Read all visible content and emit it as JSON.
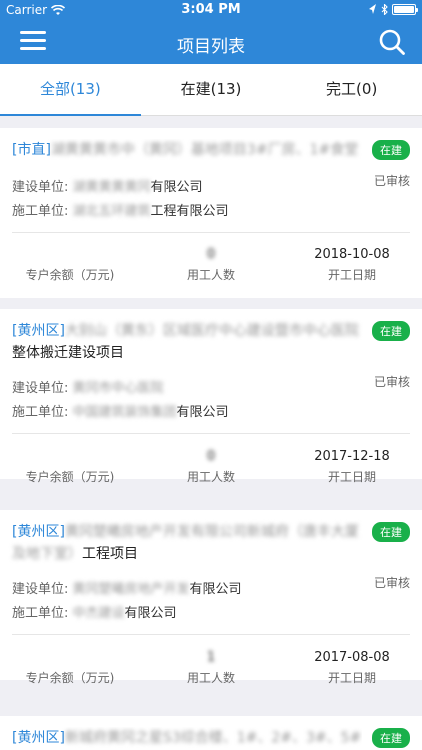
{
  "status": {
    "carrier": "Carrier",
    "time": "3:04 PM"
  },
  "nav": {
    "title": "项目列表"
  },
  "tabs": [
    {
      "label": "全部(13)",
      "active": true
    },
    {
      "label": "在建(13)",
      "active": false
    },
    {
      "label": "完工(0)",
      "active": false
    }
  ],
  "labels": {
    "builder": "建设单位:",
    "contractor": "施工单位:",
    "balance": "专户余额（万元)",
    "workers": "用工人数",
    "start_date": "开工日期"
  },
  "projects": [
    {
      "region": "[市直]",
      "name_blur": "湖黄黄黄市中（黄冈）基地项目3#厂房、1#食堂",
      "name": "",
      "badge": "在建",
      "builder_blur": "湖黄黄黄黄冈",
      "builder": "有限公司",
      "contractor_blur": "湖北五环建筑",
      "contractor": "工程有限公司",
      "audit": "已审核",
      "balance": "",
      "workers": "0",
      "start_date": "2018-10-08"
    },
    {
      "region": "[黄州区]",
      "name_blur": "大别山（黄东）区域医疗中心建设暨市中心医院",
      "name": "整体搬迁建设项目",
      "badge": "在建",
      "builder_blur": "黄冈市中心医院",
      "builder": "",
      "contractor_blur": "中国建筑装饰集团",
      "contractor": "有限公司",
      "audit": "已审核",
      "balance": "",
      "workers": "0",
      "start_date": "2017-12-18"
    },
    {
      "region": "[黄州区]",
      "name_blur": "黄冈楚曦房地产开发有限公司新城府（唐丰大厦及地下室）",
      "name": "工程项目",
      "badge": "在建",
      "builder_blur": "黄冈楚曦房地产开发",
      "builder": "有限公司",
      "contractor_blur": "中杰建设",
      "contractor": "有限公司",
      "audit": "已审核",
      "balance": "",
      "workers": "1",
      "start_date": "2017-08-08"
    },
    {
      "region": "[黄州区]",
      "name_blur": "新城府黄冈之星S3综合楼、1#、2#、3#、5#",
      "name": "",
      "badge": "在建"
    }
  ]
}
